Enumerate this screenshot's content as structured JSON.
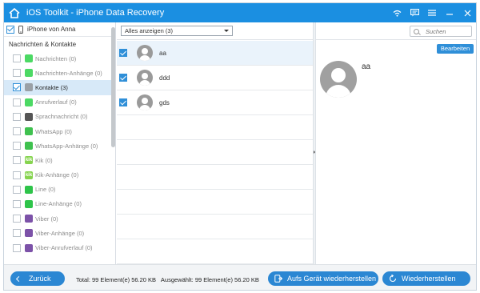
{
  "window": {
    "title": "iOS Toolkit - iPhone Data Recovery",
    "accent": "#1b8fe1",
    "controls": [
      "wifi-icon",
      "feedback-icon",
      "menu-icon",
      "minimize-icon",
      "close-icon"
    ]
  },
  "sidebar": {
    "device": "iPhone von Anna",
    "section": "Nachrichten & Kontakte",
    "items": [
      {
        "label": "Nachrichten (0)",
        "icon": "message-icon",
        "color": "#4cd964",
        "glyph": "",
        "checked": false
      },
      {
        "label": "Nachrichten-Anhänge (0)",
        "icon": "message-attachment-icon",
        "color": "#4cd964",
        "glyph": "",
        "checked": false
      },
      {
        "label": "Kontakte (3)",
        "icon": "contacts-icon",
        "color": "#9aa0a6",
        "glyph": "",
        "checked": true
      },
      {
        "label": "Anrufverlauf (0)",
        "icon": "phone-icon",
        "color": "#4cd964",
        "glyph": "",
        "checked": false
      },
      {
        "label": "Sprachnachricht (0)",
        "icon": "voicemail-icon",
        "color": "#555555",
        "glyph": "",
        "checked": false
      },
      {
        "label": "WhatsApp (0)",
        "icon": "whatsapp-icon",
        "color": "#3fc14f",
        "glyph": "",
        "checked": false
      },
      {
        "label": "WhatsApp-Anhänge (0)",
        "icon": "whatsapp-attachment-icon",
        "color": "#3fc14f",
        "glyph": "",
        "checked": false
      },
      {
        "label": "Kik (0)",
        "icon": "kik-icon",
        "color": "#86d44f",
        "glyph": "kik",
        "checked": false
      },
      {
        "label": "Kik-Anhänge (0)",
        "icon": "kik-attachment-icon",
        "color": "#86d44f",
        "glyph": "kik",
        "checked": false
      },
      {
        "label": "Line (0)",
        "icon": "line-icon",
        "color": "#2ec44a",
        "glyph": "",
        "checked": false
      },
      {
        "label": "Line-Anhänge (0)",
        "icon": "line-attachment-icon",
        "color": "#2ec44a",
        "glyph": "",
        "checked": false
      },
      {
        "label": "Viber (0)",
        "icon": "viber-icon",
        "color": "#7c52a8",
        "glyph": "",
        "checked": false
      },
      {
        "label": "Viber-Anhänge (0)",
        "icon": "viber-attachment-icon",
        "color": "#7c52a8",
        "glyph": "",
        "checked": false
      },
      {
        "label": "Viber-Anrufverlauf (0)",
        "icon": "viber-call-icon",
        "color": "#7c52a8",
        "glyph": "",
        "checked": false
      }
    ]
  },
  "toolbar": {
    "filter": "Alles anzeigen (3)",
    "search_placeholder": "Suchen"
  },
  "contacts": [
    {
      "name": "aa",
      "checked": true
    },
    {
      "name": "ddd",
      "checked": true
    },
    {
      "name": "gds",
      "checked": true
    }
  ],
  "detail": {
    "edit_label": "Bearbeiten",
    "name": "aa"
  },
  "footer": {
    "back_label": "Zurück",
    "status": "Total: 99 Element(e) 56.20 KB   Ausgewählt: 99 Element(e) 56.20 KB",
    "restore_device_label": "Aufs Gerät wiederherstellen",
    "restore_label": "Wiederherstellen"
  }
}
